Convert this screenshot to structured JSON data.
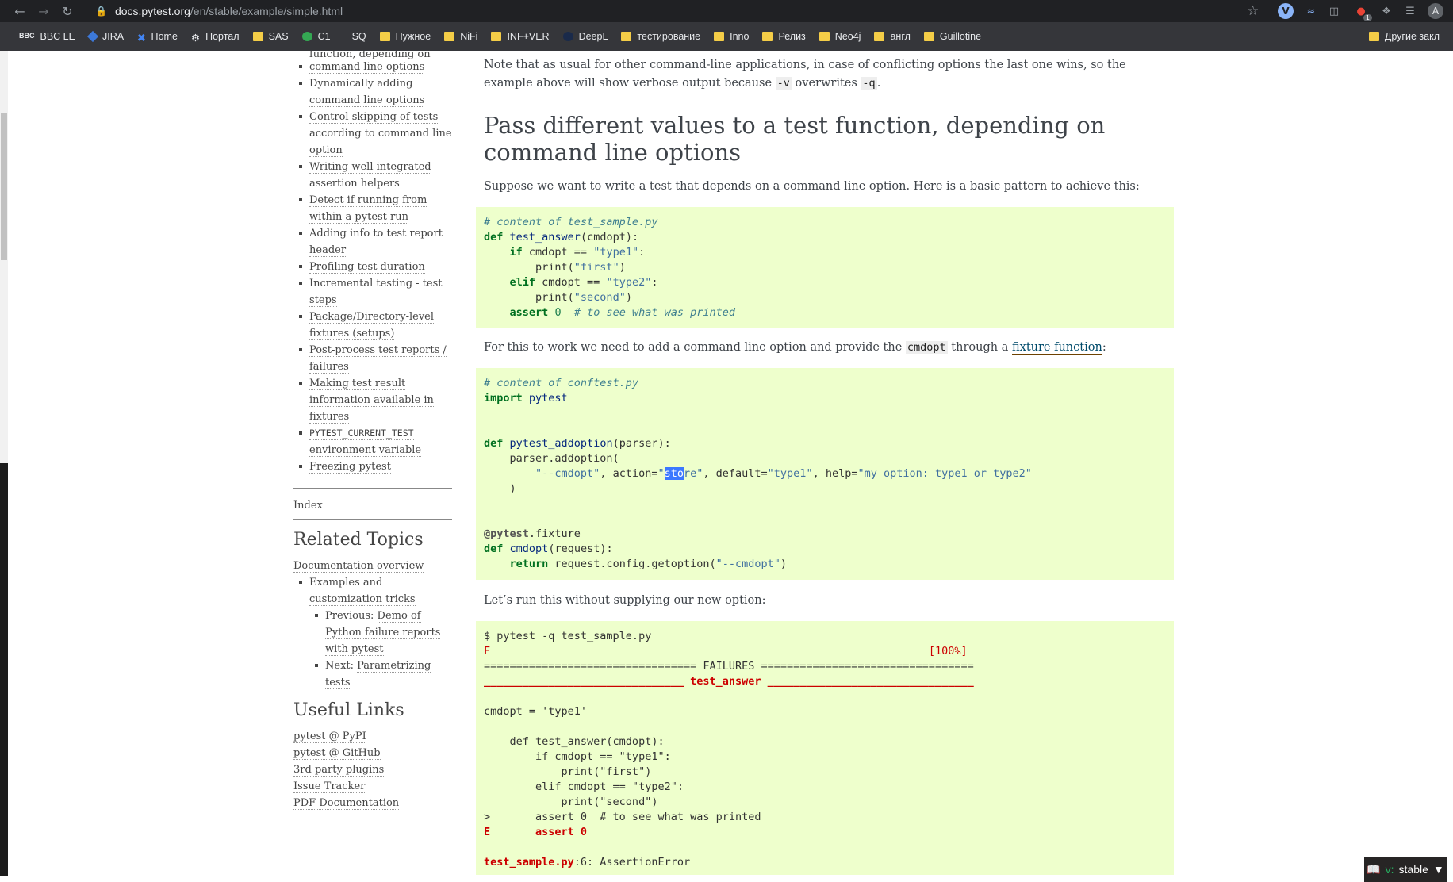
{
  "browser": {
    "url_host": "docs.pytest.org",
    "url_path": "/en/stable/example/simple.html",
    "bookmarks": [
      {
        "label": "BBC LE",
        "icon": "bbc-icon"
      },
      {
        "label": "JIRA",
        "icon": "jira-icon"
      },
      {
        "label": "Home",
        "icon": "home-icon"
      },
      {
        "label": "Портал",
        "icon": "portal-icon"
      },
      {
        "label": "SAS",
        "icon": "folder-icon"
      },
      {
        "label": "C1",
        "icon": "c1-icon"
      },
      {
        "label": "SQ",
        "icon": "sq-icon"
      },
      {
        "label": "Нужное",
        "icon": "folder-icon"
      },
      {
        "label": "NiFi",
        "icon": "folder-icon"
      },
      {
        "label": "INF+VER",
        "icon": "folder-icon"
      },
      {
        "label": "DeepL",
        "icon": "deepl-icon"
      },
      {
        "label": "тестирование",
        "icon": "folder-icon"
      },
      {
        "label": "Inno",
        "icon": "folder-icon"
      },
      {
        "label": "Релиз",
        "icon": "folder-icon"
      },
      {
        "label": "Neo4j",
        "icon": "folder-icon"
      },
      {
        "label": "англ",
        "icon": "folder-icon"
      },
      {
        "label": "Guillotine",
        "icon": "folder-icon"
      }
    ],
    "other_bookmarks": "Другие закл",
    "extensions": {
      "v_label": "V",
      "badge": "1",
      "avatar": "A"
    }
  },
  "sidebar": {
    "cut_item": "function, depending on",
    "toc": [
      {
        "label": "command line options",
        "continuation": true
      },
      {
        "label": "Dynamically adding command line options"
      },
      {
        "label": "Control skipping of tests according to command line option"
      },
      {
        "label": "Writing well integrated assertion helpers"
      },
      {
        "label": "Detect if running from within a pytest run"
      },
      {
        "label": "Adding info to test report header"
      },
      {
        "label": "Profiling test duration"
      },
      {
        "label": "Incremental testing - test steps"
      },
      {
        "label": "Package/Directory-level fixtures (setups)"
      },
      {
        "label": "Post-process test reports / failures"
      },
      {
        "label": "Making test result information available in fixtures"
      },
      {
        "label": "PYTEST_CURRENT_TEST",
        "suffix": "environment variable"
      },
      {
        "label": "Freezing pytest"
      }
    ],
    "index": "Index",
    "related_title": "Related Topics",
    "related": {
      "overview": "Documentation overview",
      "examples": "Examples and customization tricks",
      "previous_prefix": "Previous: ",
      "previous": "Demo of Python failure reports with pytest",
      "next_prefix": "Next: ",
      "next": "Parametrizing tests"
    },
    "useful_title": "Useful Links",
    "useful": [
      "pytest @ PyPI",
      "pytest @ GitHub",
      "3rd party plugins",
      "Issue Tracker",
      "PDF Documentation"
    ]
  },
  "main": {
    "note_text_1": "Note that as usual for other command-line applications, in case of conflicting options the last one wins, so the example above will show verbose output because ",
    "note_code_1": "-v",
    "note_text_2": " overwrites ",
    "note_code_2": "-q",
    "note_text_3": ".",
    "heading": "Pass different values to a test function, depending on command line options",
    "intro": "Suppose we want to write a test that depends on a command line option. Here is a basic pattern to achieve this:",
    "para2_text_1": "For this to work we need to add a command line option and provide the ",
    "para2_code": "cmdopt",
    "para2_text_2": " through a ",
    "para2_link": "fixture function",
    "para2_text_3": ":",
    "para3": "Let’s run this without supplying our new option:"
  },
  "version_badge": {
    "prefix": "v:",
    "version": "stable"
  }
}
